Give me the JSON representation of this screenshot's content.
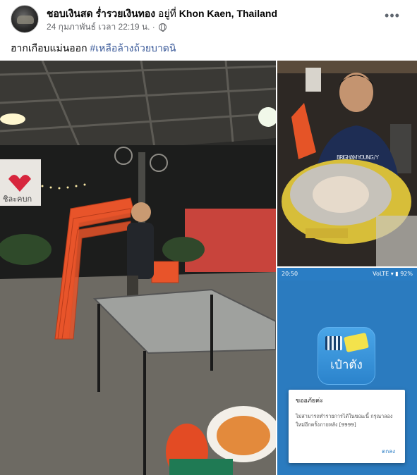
{
  "post": {
    "author": "ชอบเงินสด ร่ำรวยเงินทอง",
    "location_prefix": "อยู่ที่",
    "location": "Khon Kaen, Thailand",
    "timestamp": "24 กุมภาพันธ์ เวลา 22:19 น. ·",
    "privacy_icon": "globe-icon",
    "more_icon": "more-options-icon",
    "caption": "ฮากเกือบแม่นออก",
    "hashtag": "#เหลือล้างถ้วยบาดนิ"
  },
  "phone_screenshot": {
    "status_time": "20:50",
    "status_right": "VoLTE ▾ ▮ 92%",
    "app_name": "เป๋าตัง",
    "alert_title": "ขออภัยค่ะ",
    "alert_message": "ไม่สามารถทำรายการได้ในขณะนี้ กรุณาลองใหม่อีกครั้งภายหลัง [9999]",
    "alert_button": "ตกลง"
  },
  "photo_text": {
    "banner": "ชิละคบก",
    "shirt": "BRIGHAM YOUNG / Y"
  },
  "colors": {
    "link": "#385898",
    "meta": "#65676b",
    "app_blue": "#2a7dc4",
    "chair_orange": "#e8542a"
  }
}
